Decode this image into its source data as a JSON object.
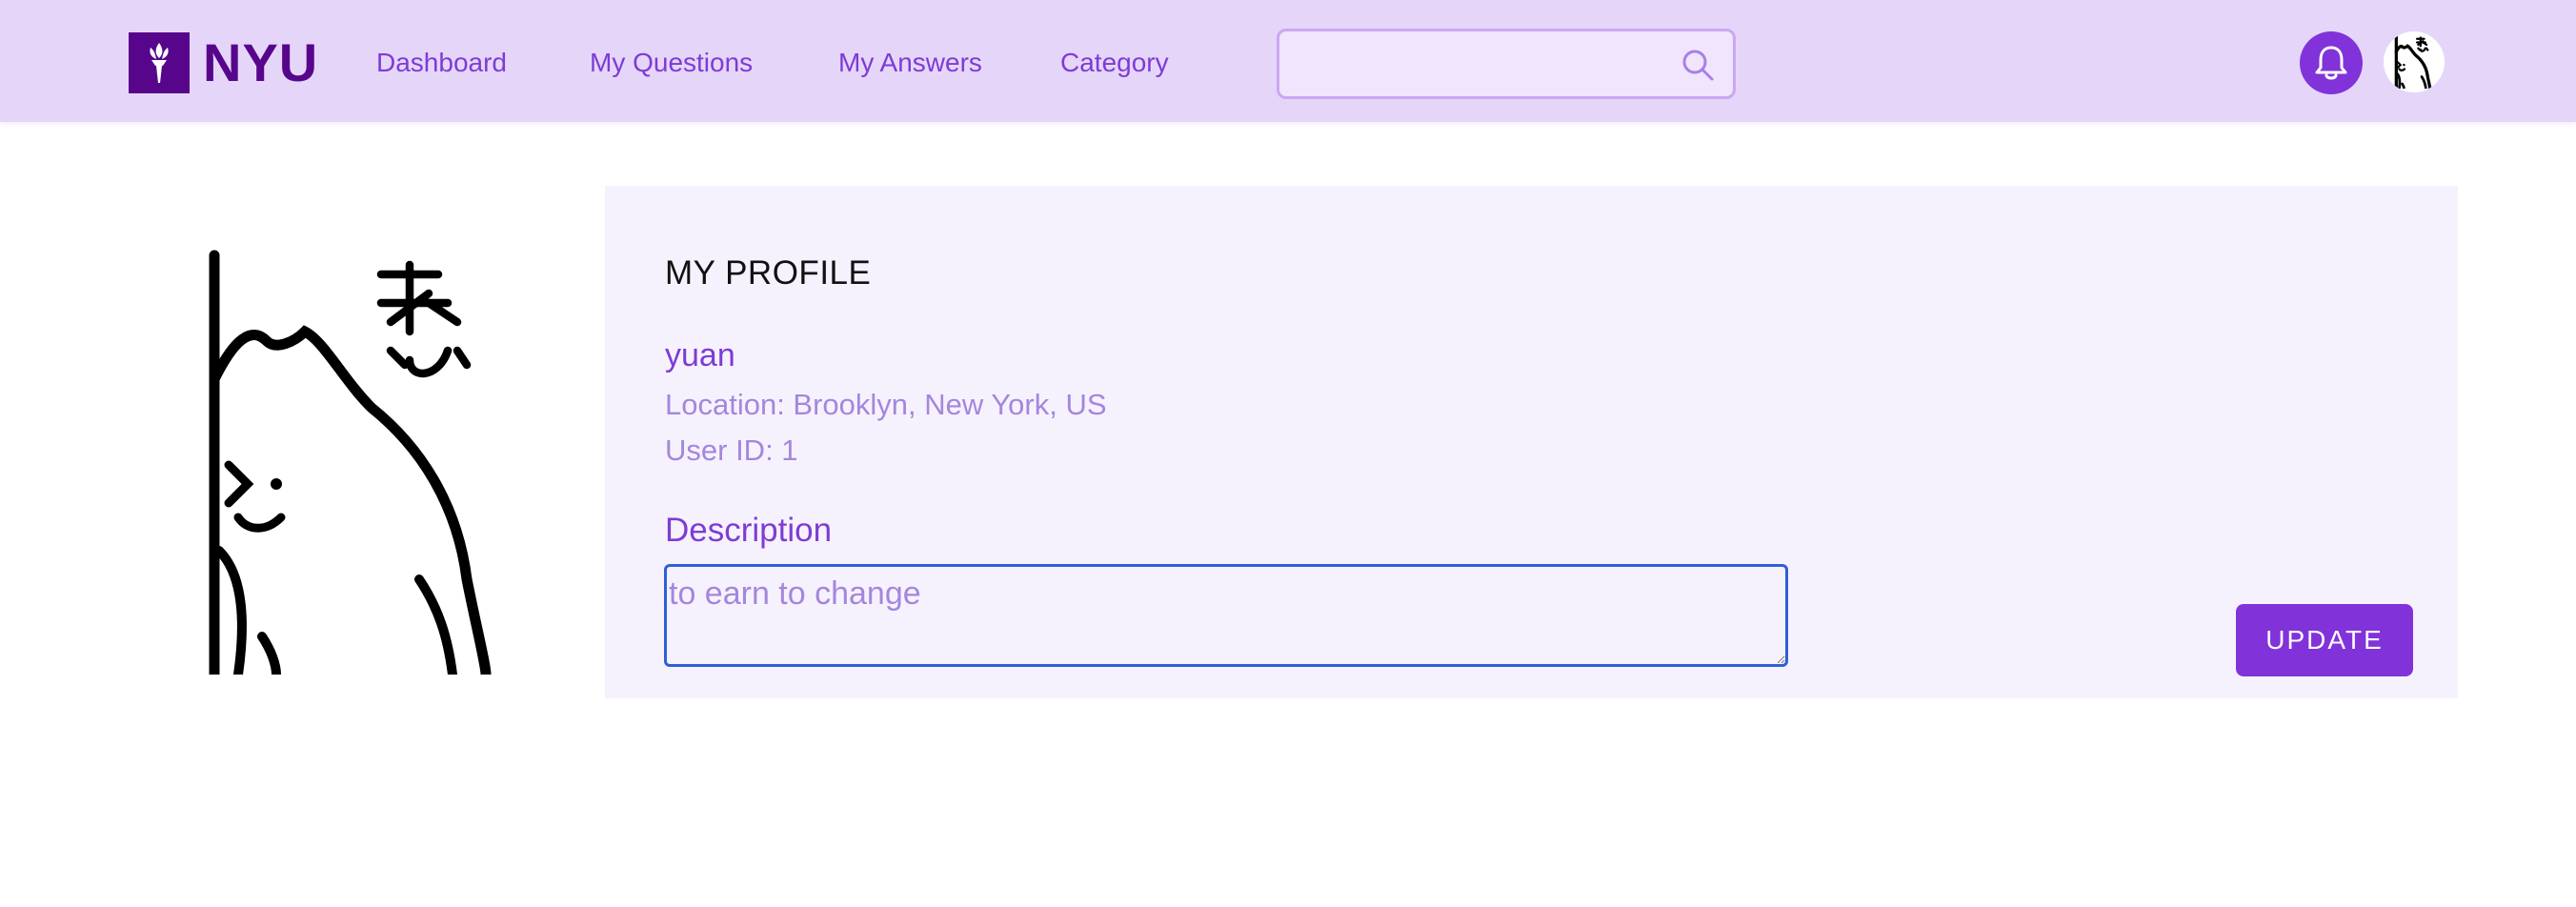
{
  "brand": {
    "name": "NYU"
  },
  "nav": {
    "links": [
      "Dashboard",
      "My Questions",
      "My Answers",
      "Category"
    ]
  },
  "search": {
    "value": "",
    "icon": "search-icon"
  },
  "header_icons": {
    "notifications": "bell-icon",
    "avatar": "user-avatar"
  },
  "profile": {
    "title": "MY PROFILE",
    "username": "yuan",
    "location": "Location: Brooklyn, New York, US",
    "user_id": "User ID: 1",
    "description_label": "Description",
    "description_value": "to earn to change",
    "update_label": "UPDATE"
  },
  "colors": {
    "nav_bg": "#e5d6f9",
    "brand": "#57068c",
    "accent": "#8133d9",
    "link": "#7e3bd6",
    "muted": "#a486dd",
    "card_bg": "#f6f2fd",
    "focus_border": "#2f5fd6"
  }
}
